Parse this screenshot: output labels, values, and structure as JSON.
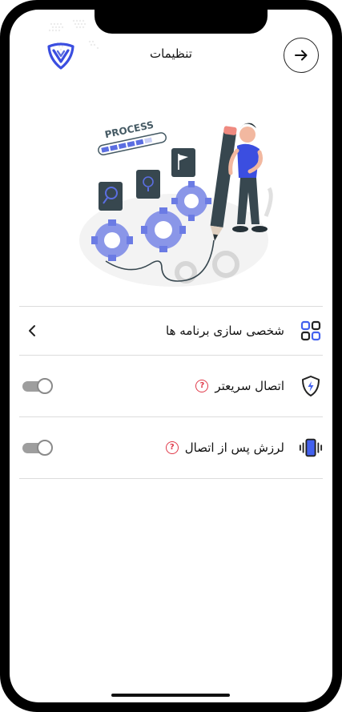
{
  "header": {
    "title": "تنظیمات"
  },
  "settings": {
    "items": [
      {
        "label": "شخصی سازی برنامه ها",
        "icon": "apps-grid-icon",
        "control": "chevron"
      },
      {
        "label": "اتصال سریعتر",
        "icon": "shield-bolt-icon",
        "control": "toggle",
        "toggle_on": false,
        "help": "?"
      },
      {
        "label": "لرزش پس از اتصال",
        "icon": "vibrate-phone-icon",
        "control": "toggle",
        "toggle_on": false,
        "help": "?"
      }
    ]
  },
  "illustration": {
    "text": "PROCESS"
  },
  "colors": {
    "accent": "#5b6ee1",
    "help": "#e03a4a",
    "toggle_off": "#9e9e9e"
  }
}
